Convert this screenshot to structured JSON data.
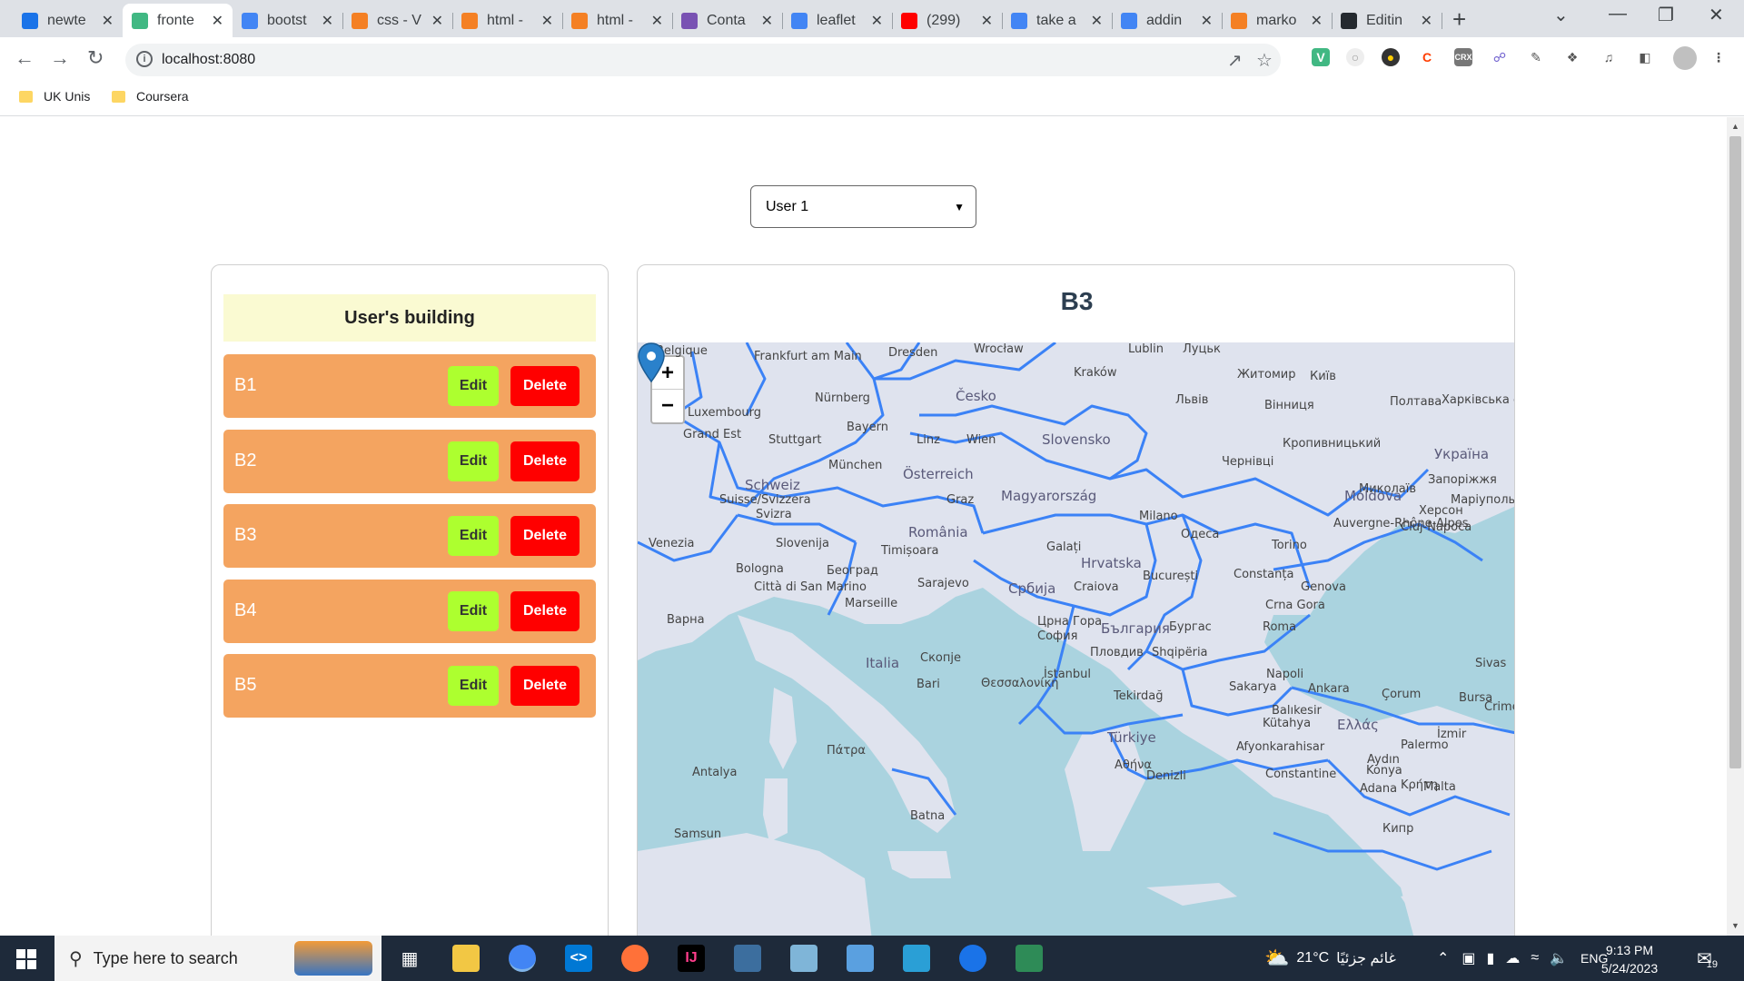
{
  "browser": {
    "tabs": [
      {
        "title": "newte",
        "favicon": "lightbulb-icon",
        "color": "#1a73e8"
      },
      {
        "title": "fronte",
        "favicon": "vue-icon",
        "color": "#41b883",
        "active": true
      },
      {
        "title": "bootst",
        "favicon": "google-icon",
        "color": "#4285f4"
      },
      {
        "title": "css - V",
        "favicon": "stackoverflow-icon",
        "color": "#f48024"
      },
      {
        "title": "html -",
        "favicon": "stackoverflow-icon",
        "color": "#f48024"
      },
      {
        "title": "html -",
        "favicon": "stackoverflow-icon",
        "color": "#f48024"
      },
      {
        "title": "Conta",
        "favicon": "bootstrap-icon",
        "color": "#7952b3"
      },
      {
        "title": "leaflet",
        "favicon": "google-icon",
        "color": "#4285f4"
      },
      {
        "title": "(299)",
        "favicon": "youtube-icon",
        "color": "#ff0000"
      },
      {
        "title": "take a",
        "favicon": "google-icon",
        "color": "#4285f4"
      },
      {
        "title": "addin",
        "favicon": "google-icon",
        "color": "#4285f4"
      },
      {
        "title": "marko",
        "favicon": "stackoverflow-icon",
        "color": "#f48024"
      },
      {
        "title": "Editin",
        "favicon": "github-icon",
        "color": "#24292f"
      }
    ],
    "url": "localhost:8080",
    "bookmarks": [
      "UK Unis",
      "Coursera"
    ]
  },
  "app": {
    "user_select": {
      "value": "User 1"
    },
    "sidebar_title": "User's building",
    "buildings": [
      {
        "name": "B1",
        "edit": "Edit",
        "delete": "Delete"
      },
      {
        "name": "B2",
        "edit": "Edit",
        "delete": "Delete"
      },
      {
        "name": "B3",
        "edit": "Edit",
        "delete": "Delete"
      },
      {
        "name": "B4",
        "edit": "Edit",
        "delete": "Delete"
      },
      {
        "name": "B5",
        "edit": "Edit",
        "delete": "Delete"
      }
    ],
    "selected_building": "B3",
    "colors": {
      "header_bg": "#fafad2",
      "row_bg": "#f4a460",
      "edit_bg": "#adff2f",
      "delete_bg": "#ff0000",
      "boundary": "#3b82f6"
    }
  },
  "map": {
    "zoom_in": "+",
    "zoom_out": "−",
    "labels": [
      "Belgique",
      "Frankfurt am Main",
      "Dresden",
      "Wrocław",
      "Lublin",
      "Луцьк",
      "Житомир",
      "Київ",
      "Kraków",
      "Česko",
      "Nürnberg",
      "Львів",
      "Вінниця",
      "Полтава",
      "Харківська область",
      "Luxembourg",
      "Bayern",
      "Grand Est",
      "Stuttgart",
      "Linz",
      "Wien",
      "Slovensko",
      "Кропивницький",
      "Україна",
      "München",
      "Österreich",
      "Чернівці",
      "Schweiz",
      "Suisse/Svizzera",
      "Svizra",
      "Graz",
      "Magyarország",
      "Moldova",
      "Миколаїв",
      "Запоріжжя",
      "Маріуполь",
      "Херсон",
      "Cluj-Napoca",
      "Milano",
      "Slovenija",
      "România",
      "Одеса",
      "Auvergne-Rhône-Alpes",
      "Venezia",
      "Timișoara",
      "Galați",
      "Torino",
      "Bologna",
      "Београд",
      "Hrvatska",
      "Sarajevo",
      "Србија",
      "Craiova",
      "București",
      "Constanța",
      "Genova",
      "Città di San Marino",
      "Marseille",
      "Варна",
      "Crna Gora",
      "Црна Гора",
      "София",
      "България",
      "Бургас",
      "Roma",
      "Italia",
      "Скопје",
      "Пловдив",
      "Shqipëria",
      "İstanbul",
      "Napoli",
      "Bari",
      "Θεσσαλονίκη",
      "Tekirdağ",
      "Sakarya",
      "Ankara",
      "Çorum",
      "Bursa",
      "Balıkesir",
      "Kütahya",
      "Ελλάς",
      "Türkiye",
      "İzmir",
      "Afyonkarahisar",
      "Palermo",
      "Πάτρα",
      "Αθήνα",
      "Denizli",
      "Konya",
      "Aydın",
      "Constantine",
      "Antalya",
      "Adana",
      "Malta",
      "Batna",
      "Samsun",
      "Sivas",
      "Crimea",
      "Κρήτη",
      "Кипр"
    ]
  },
  "taskbar": {
    "search_placeholder": "Type here to search",
    "weather": "21°C",
    "weather_desc": "غائم جزئيًا",
    "language": "ENG",
    "time": "9:13 PM",
    "date": "5/24/2023",
    "notifications": "19"
  }
}
